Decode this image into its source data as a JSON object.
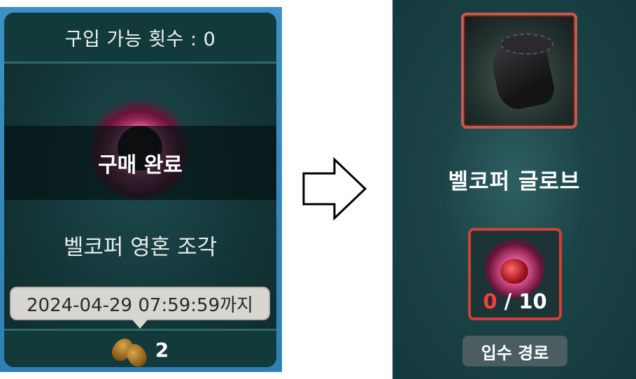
{
  "shop_card": {
    "purchase_limit": "구입 가능 횟수 : 0",
    "status_overlay": "구매 완료",
    "item_name": "벨코퍼 영혼 조각",
    "deadline": "2024-04-29 07:59:59까지",
    "price": "2",
    "price_icon": "seed-currency-icon",
    "item_icon": "soul-fragment-icon"
  },
  "arrow_icon": "right-arrow-icon",
  "equipment_panel": {
    "item_name": "벨코퍼 글로브",
    "item_icon": "glove-icon",
    "material": {
      "icon": "soul-fragment-icon",
      "owned": "0",
      "separator": " / ",
      "required": "10"
    },
    "acquisition_button": "입수 경로"
  },
  "colors": {
    "card_border_blue": "#3b91c6",
    "panel_bg": "#1b4245",
    "frame_red": "#c4594f",
    "material_border": "#d0403b",
    "owned_count_red": "#ff3b3b"
  }
}
